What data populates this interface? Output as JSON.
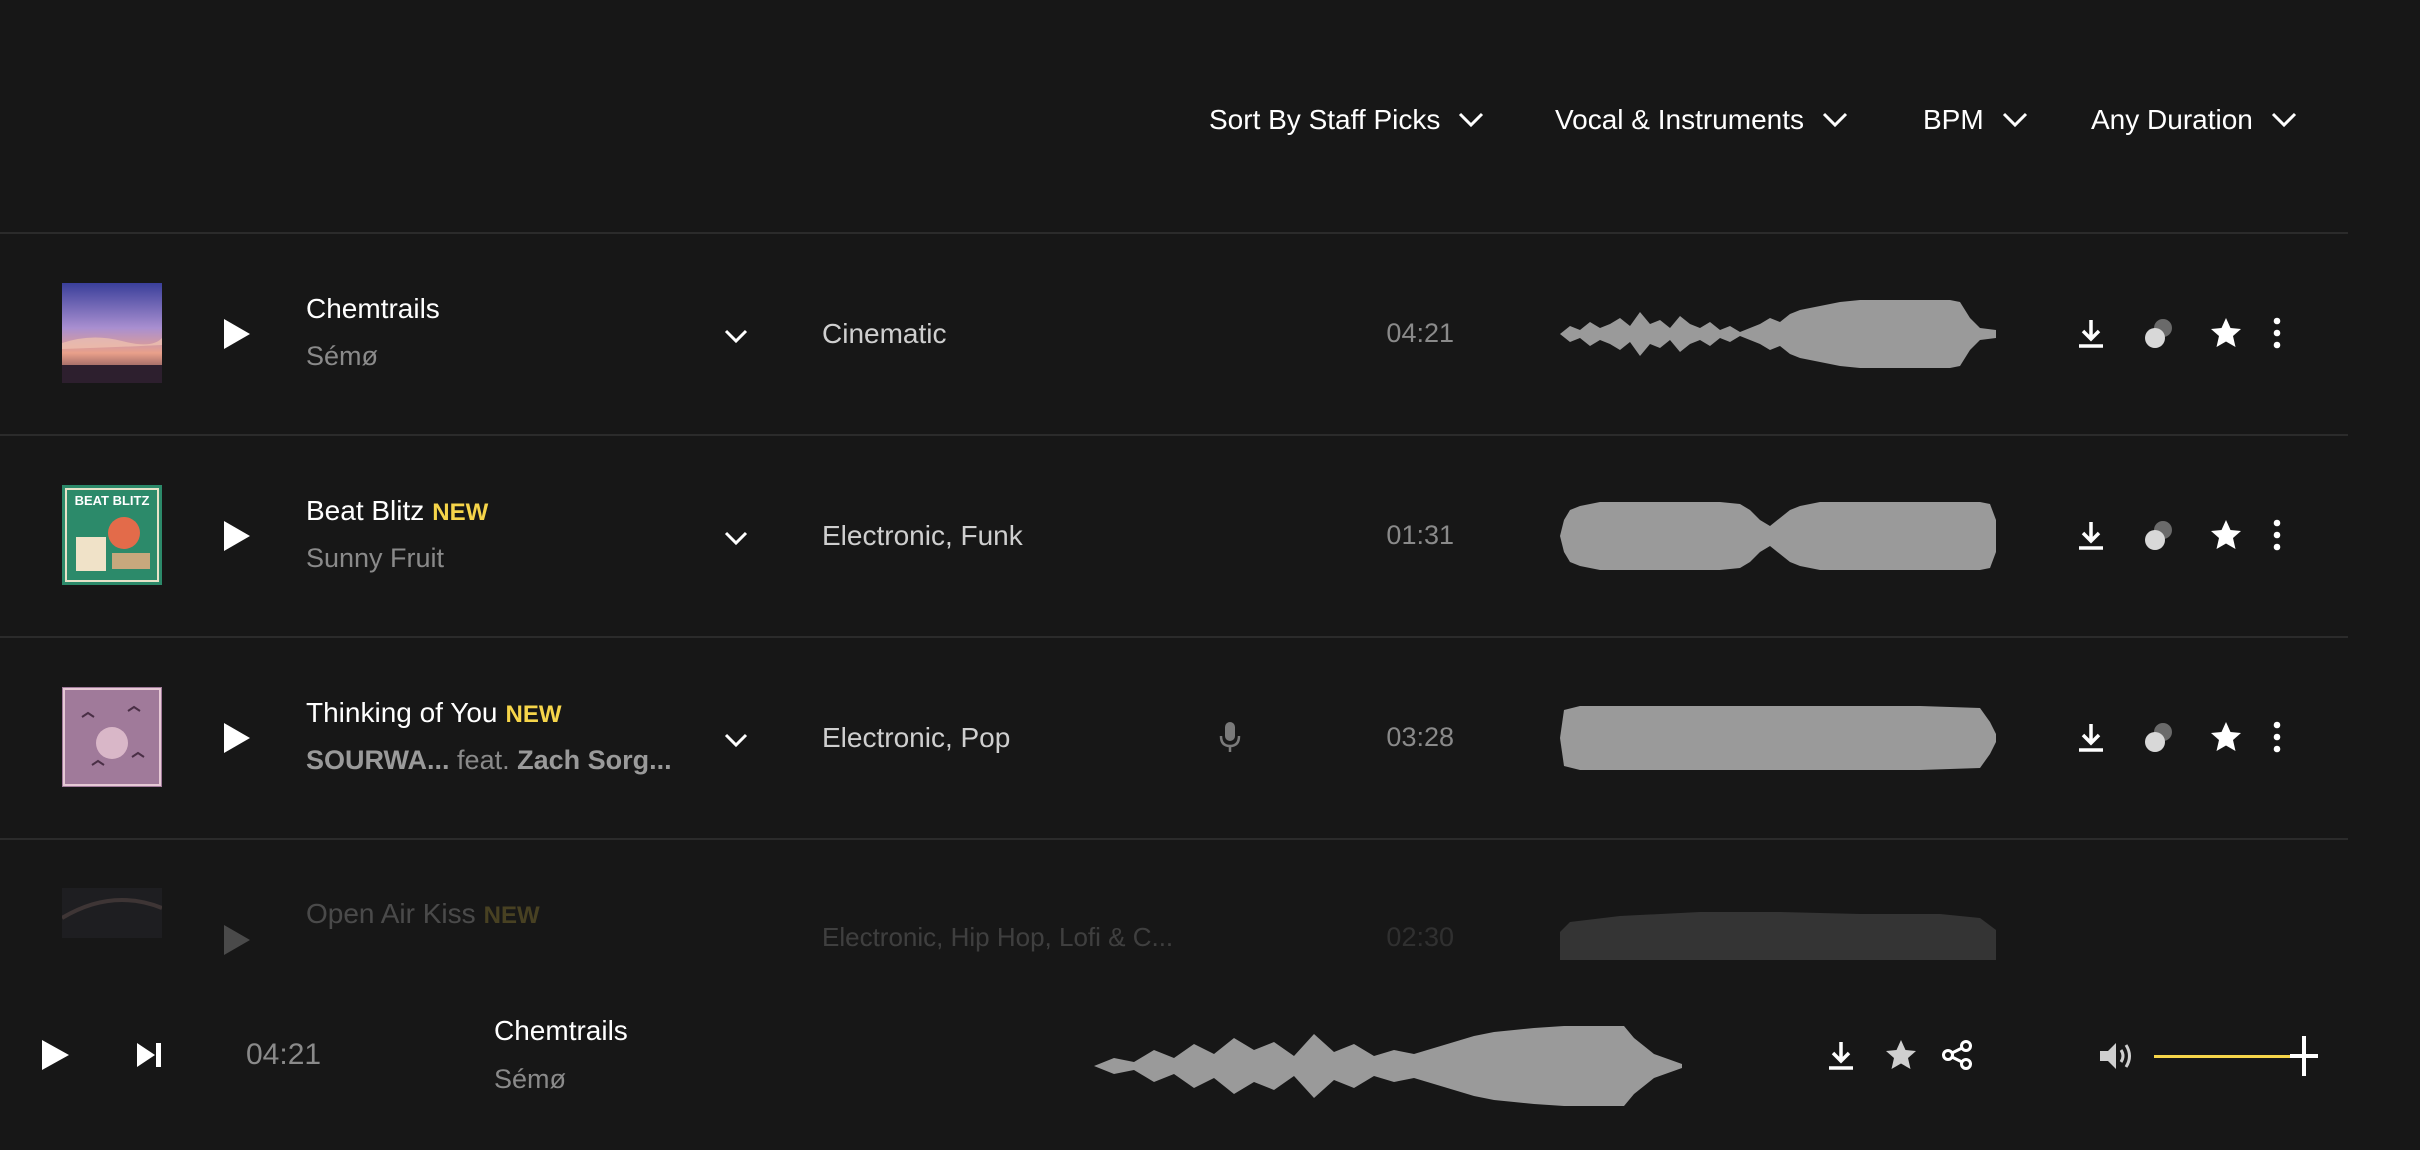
{
  "filters": {
    "sort": "Sort By Staff Picks",
    "vocal": "Vocal & Instruments",
    "bpm": "BPM",
    "duration": "Any Duration"
  },
  "tracks": [
    {
      "title": "Chemtrails",
      "badge": "",
      "artist": "Sémø",
      "feat_label": "",
      "feat_artist": "",
      "genre": "Cinematic",
      "duration": "04:21",
      "vocals": false
    },
    {
      "title": "Beat Blitz",
      "badge": "NEW",
      "artist": "Sunny Fruit",
      "feat_label": "",
      "feat_artist": "",
      "genre": "Electronic, Funk",
      "duration": "01:31",
      "vocals": false
    },
    {
      "title": "Thinking of You",
      "badge": "NEW",
      "artist": "SOURWA...",
      "feat_label": "feat.",
      "feat_artist": "Zach Sorg...",
      "genre": "Electronic, Pop",
      "duration": "03:28",
      "vocals": true
    },
    {
      "title": "Open Air Kiss",
      "badge": "NEW",
      "artist": "",
      "feat_label": "",
      "feat_artist": "",
      "genre": "Electronic, Hip Hop, Lofi & C...",
      "duration": "02:30",
      "vocals": false
    }
  ],
  "player": {
    "time": "04:21",
    "title": "Chemtrails",
    "artist": "Sémø",
    "volume": 0.8
  },
  "colors": {
    "accent": "#f6d54a",
    "background": "#171717",
    "wave": "#9a9a9a"
  },
  "icons": [
    "chevron-down-icon",
    "play-icon",
    "skip-next-icon",
    "microphone-icon",
    "download-icon",
    "stems-icon",
    "star-icon",
    "more-vertical-icon",
    "share-icon",
    "volume-icon"
  ]
}
